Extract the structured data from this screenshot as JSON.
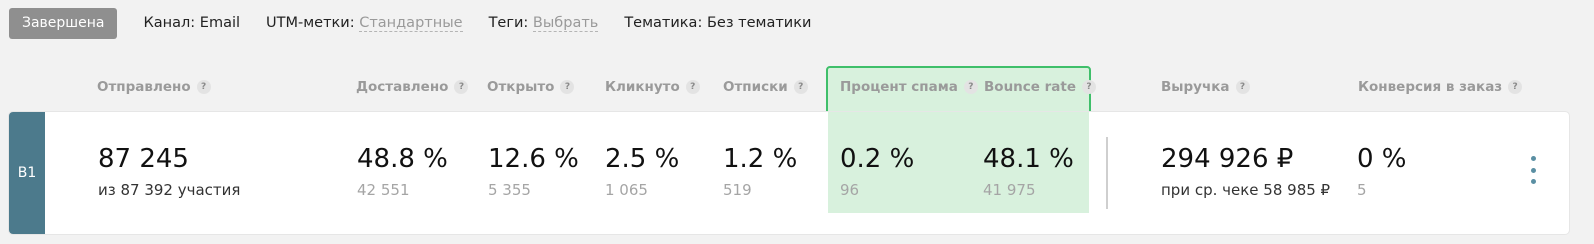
{
  "header": {
    "status": "Завершена",
    "channel_label": "Канал: Email",
    "utm_label": "UTM-метки:",
    "utm_value": "Стандартные",
    "tags_label": "Теги:",
    "tags_value": "Выбрать",
    "topic_label": "Тематика:",
    "topic_value": "Без тематики"
  },
  "columns": {
    "sent": "Отправлено",
    "delivered": "Доставлено",
    "opened": "Открыто",
    "clicked": "Кликнуто",
    "unsubscribes": "Отписки",
    "spam_rate": "Процент спама",
    "bounce_rate": "Bounce rate",
    "revenue": "Выручка",
    "conversion": "Конверсия в заказ",
    "help_glyph": "?"
  },
  "row": {
    "variant": "B1",
    "sent_value": "87 245",
    "sent_sub": "из 87 392 участия",
    "delivered_value": "48.8 %",
    "delivered_sub": "42 551",
    "opened_value": "12.6 %",
    "opened_sub": "5 355",
    "clicked_value": "2.5 %",
    "clicked_sub": "1 065",
    "unsub_value": "1.2 %",
    "unsub_sub": "519",
    "spam_value": "0.2 %",
    "spam_sub": "96",
    "bounce_value": "48.1 %",
    "bounce_sub": "41 975",
    "revenue_value": "294 926 ₽",
    "revenue_sub": "при ср. чеке 58 985 ₽",
    "conversion_value": "0 %",
    "conversion_sub": "5"
  },
  "colors": {
    "highlight_fill": "#d8f1dd",
    "highlight_border": "#3fbf6a",
    "variant_strip": "#4c7a8c",
    "status_badge": "#8f8f8f"
  },
  "icons": {
    "help": "help-icon",
    "more": "more-vertical-icon"
  }
}
